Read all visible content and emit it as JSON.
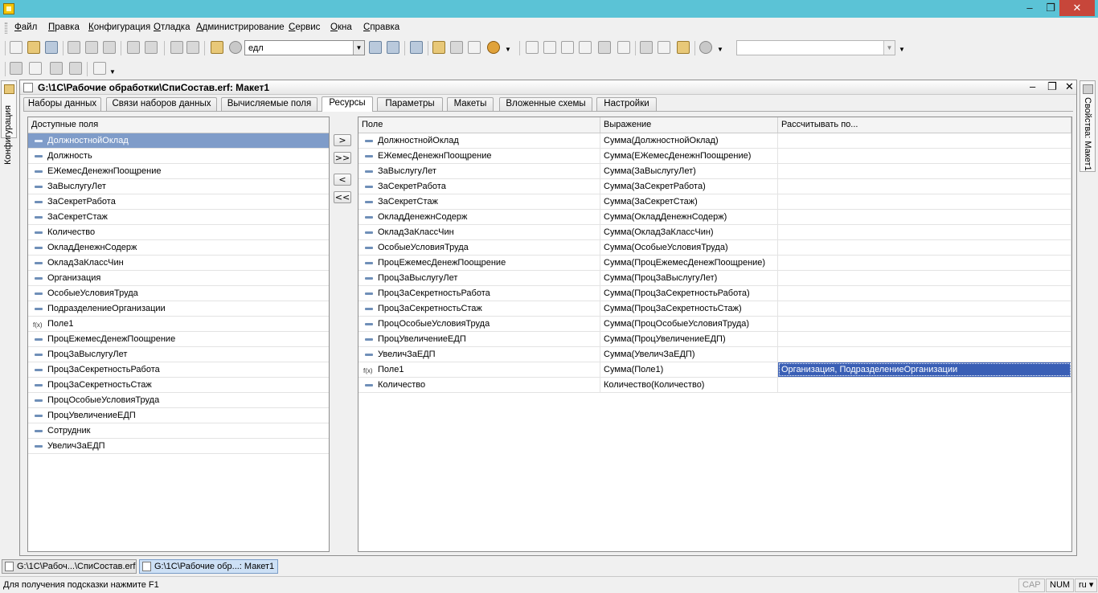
{
  "window": {
    "title": "",
    "minimize": "–",
    "maximize": "❐",
    "close": "✕"
  },
  "menu": [
    "Файл",
    "Правка",
    "Конфигурация",
    "Отладка",
    "Администрирование",
    "Сервис",
    "Окна",
    "Справка"
  ],
  "toolbar": {
    "search_value": "едл"
  },
  "side_panels": {
    "left_label": "Конфигурация",
    "right_label": "Свойства: Макет1"
  },
  "document": {
    "title": "G:\\1С\\Рабочие обработки\\СпиСостав.erf: Макет1",
    "tabs": [
      "Наборы данных",
      "Связи наборов данных",
      "Вычисляемые поля",
      "Ресурсы",
      "Параметры",
      "Макеты",
      "Вложенные схемы",
      "Настройки"
    ],
    "active_tab": "Ресурсы"
  },
  "available_fields": {
    "header": "Доступные поля",
    "items": [
      {
        "label": "ДолжностнойОклад",
        "icon": "field-icon",
        "selected": true
      },
      {
        "label": "Должность",
        "icon": "field-icon"
      },
      {
        "label": "ЕЖемесДенежнПоощрение",
        "icon": "field-icon"
      },
      {
        "label": "ЗаВыслугуЛет",
        "icon": "field-icon"
      },
      {
        "label": "ЗаСекретРабота",
        "icon": "field-icon"
      },
      {
        "label": "ЗаСекретСтаж",
        "icon": "field-icon"
      },
      {
        "label": "Количество",
        "icon": "field-icon"
      },
      {
        "label": "ОкладДенежнСодерж",
        "icon": "field-icon"
      },
      {
        "label": "ОкладЗаКлассЧин",
        "icon": "field-icon"
      },
      {
        "label": "Организация",
        "icon": "field-icon"
      },
      {
        "label": "ОсобыеУсловияТруда",
        "icon": "field-icon"
      },
      {
        "label": "ПодразделениеОрганизации",
        "icon": "field-icon"
      },
      {
        "label": "Поле1",
        "icon": "calc-field-icon"
      },
      {
        "label": "ПроцЕжемесДенежПоощрение",
        "icon": "field-icon"
      },
      {
        "label": "ПроцЗаВыслугуЛет",
        "icon": "field-icon"
      },
      {
        "label": "ПроцЗаСекретностьРабота",
        "icon": "field-icon"
      },
      {
        "label": "ПроцЗаСекретностьСтаж",
        "icon": "field-icon"
      },
      {
        "label": "ПроцОсобыеУсловияТруда",
        "icon": "field-icon"
      },
      {
        "label": "ПроцУвеличениеЕДП",
        "icon": "field-icon"
      },
      {
        "label": "Сотрудник",
        "icon": "field-icon"
      },
      {
        "label": "УвеличЗаЕДП",
        "icon": "field-icon"
      }
    ]
  },
  "move_buttons": [
    ">",
    ">>",
    "<",
    "<<"
  ],
  "resources": {
    "columns": [
      "Поле",
      "Выражение",
      "Рассчитывать по..."
    ],
    "rows": [
      {
        "field": "ДолжностнойОклад",
        "expr": "Сумма(ДолжностнойОклад)",
        "calc": "",
        "icon": "field-icon"
      },
      {
        "field": "ЕЖемесДенежнПоощрение",
        "expr": "Сумма(ЕЖемесДенежнПоощрение)",
        "calc": "",
        "icon": "field-icon"
      },
      {
        "field": "ЗаВыслугуЛет",
        "expr": "Сумма(ЗаВыслугуЛет)",
        "calc": "",
        "icon": "field-icon"
      },
      {
        "field": "ЗаСекретРабота",
        "expr": "Сумма(ЗаСекретРабота)",
        "calc": "",
        "icon": "field-icon"
      },
      {
        "field": "ЗаСекретСтаж",
        "expr": "Сумма(ЗаСекретСтаж)",
        "calc": "",
        "icon": "field-icon"
      },
      {
        "field": "ОкладДенежнСодерж",
        "expr": "Сумма(ОкладДенежнСодерж)",
        "calc": "",
        "icon": "field-icon"
      },
      {
        "field": "ОкладЗаКлассЧин",
        "expr": "Сумма(ОкладЗаКлассЧин)",
        "calc": "",
        "icon": "field-icon"
      },
      {
        "field": "ОсобыеУсловияТруда",
        "expr": "Сумма(ОсобыеУсловияТруда)",
        "calc": "",
        "icon": "field-icon"
      },
      {
        "field": "ПроцЕжемесДенежПоощрение",
        "expr": "Сумма(ПроцЕжемесДенежПоощрение)",
        "calc": "",
        "icon": "field-icon"
      },
      {
        "field": "ПроцЗаВыслугуЛет",
        "expr": "Сумма(ПроцЗаВыслугуЛет)",
        "calc": "",
        "icon": "field-icon"
      },
      {
        "field": "ПроцЗаСекретностьРабота",
        "expr": "Сумма(ПроцЗаСекретностьРабота)",
        "calc": "",
        "icon": "field-icon"
      },
      {
        "field": "ПроцЗаСекретностьСтаж",
        "expr": "Сумма(ПроцЗаСекретностьСтаж)",
        "calc": "",
        "icon": "field-icon"
      },
      {
        "field": "ПроцОсобыеУсловияТруда",
        "expr": "Сумма(ПроцОсобыеУсловияТруда)",
        "calc": "",
        "icon": "field-icon"
      },
      {
        "field": "ПроцУвеличениеЕДП",
        "expr": "Сумма(ПроцУвеличениеЕДП)",
        "calc": "",
        "icon": "field-icon"
      },
      {
        "field": "УвеличЗаЕДП",
        "expr": "Сумма(УвеличЗаЕДП)",
        "calc": "",
        "icon": "field-icon"
      },
      {
        "field": "Поле1",
        "expr": "Сумма(Поле1)",
        "calc": "Организация, ПодразделениеОрганизации",
        "icon": "calc-field-icon",
        "selected": true
      },
      {
        "field": "Количество",
        "expr": "Количество(Количество)",
        "calc": "",
        "icon": "field-icon"
      }
    ]
  },
  "window_tabs": [
    {
      "label": "G:\\1С\\Рабоч...\\СпиСостав.erf",
      "active": false
    },
    {
      "label": "G:\\1С\\Рабочие обр...: Макет1",
      "active": true
    }
  ],
  "statusbar": {
    "hint": "Для получения подсказки нажмите F1",
    "cap": "CAP",
    "num": "NUM",
    "lang": "ru ▾"
  },
  "colors": {
    "titlebar": "#5bc3d6",
    "selection_row": "#7f9cc9",
    "selection_cell": "#3a5fb5"
  }
}
